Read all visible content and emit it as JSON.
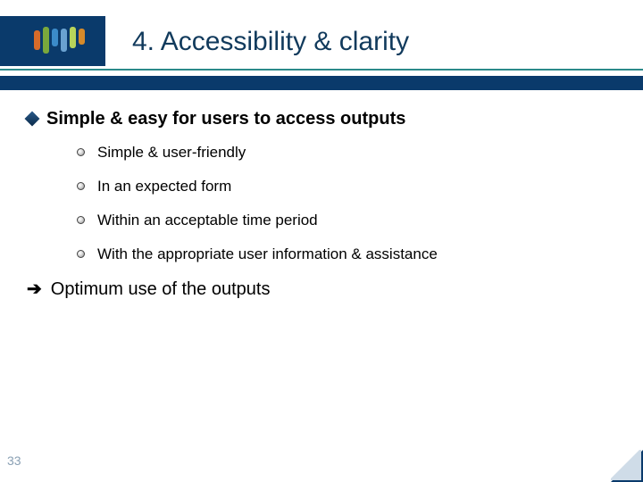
{
  "slide": {
    "title": "4. Accessibility & clarity",
    "number": "33"
  },
  "content": {
    "main_bullet": "Simple & easy for users to access outputs",
    "sub_bullets": [
      "Simple & user-friendly",
      "In an expected form",
      "Within an acceptable time period",
      "With the appropriate user information & assistance"
    ],
    "conclusion": "Optimum use of the outputs"
  }
}
